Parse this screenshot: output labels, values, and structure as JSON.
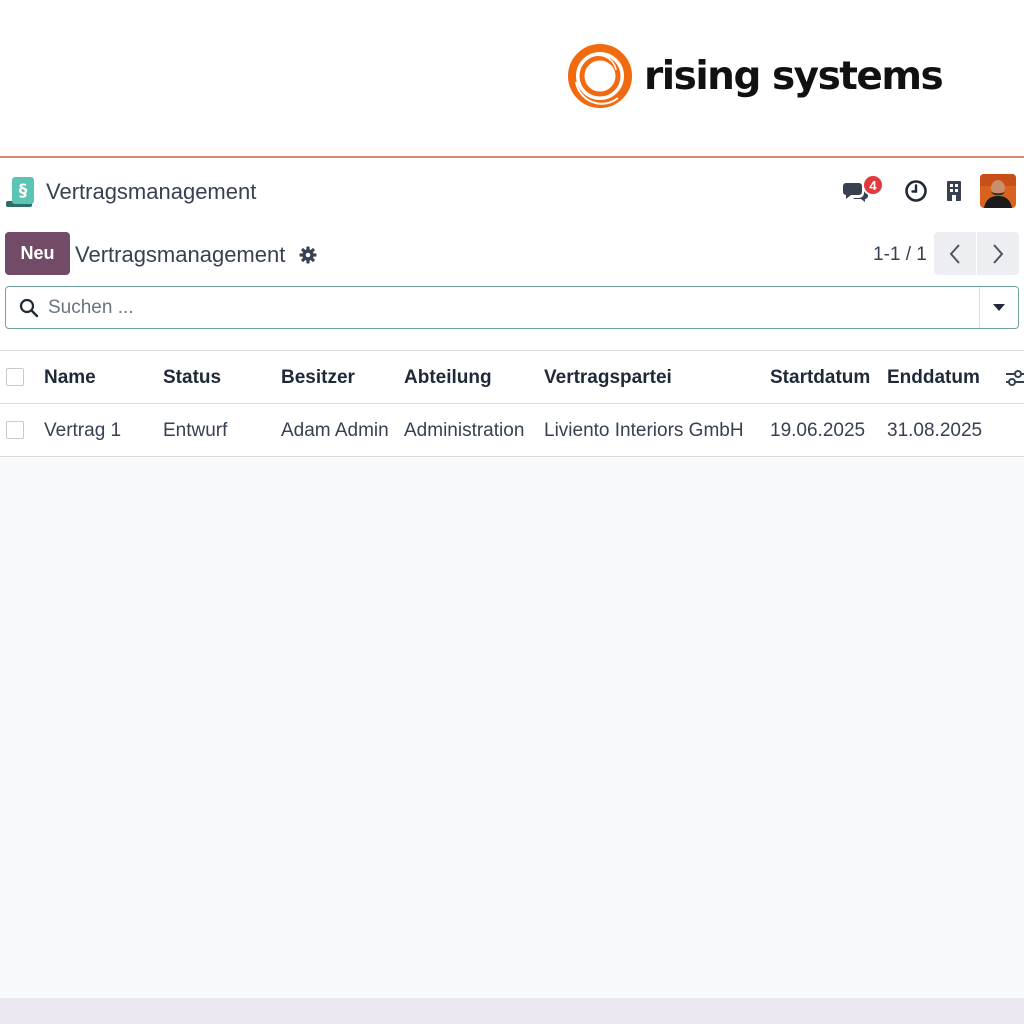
{
  "banner": {
    "brand_name": "rising systems",
    "logo_icon": "orange-ring-logo",
    "brand_color": "#f26a10"
  },
  "navbar": {
    "app_title": "Vertragsmanagement",
    "app_icon": "paragraph-document-icon",
    "chat_badge": "4",
    "icons": [
      "chat-icon",
      "clock-icon",
      "company-icon",
      "avatar"
    ]
  },
  "control_panel": {
    "new_label": "Neu",
    "title": "Vertragsmanagement",
    "pager": "1-1 / 1",
    "search_placeholder": "Suchen ..."
  },
  "list": {
    "columns": [
      "Name",
      "Status",
      "Besitzer",
      "Abteilung",
      "Vertragspartei",
      "Startdatum",
      "Enddatum"
    ],
    "rows": [
      [
        "Vertrag 1",
        "Entwurf",
        "Adam Admin",
        "Administration",
        "Liviento Interiors GmbH",
        "19.06.2025",
        "31.08.2025"
      ]
    ]
  },
  "colors": {
    "primary": "#714b67",
    "badge": "#e03a3e",
    "accent_border": "#d98b72",
    "search_border": "#6ea39c"
  }
}
